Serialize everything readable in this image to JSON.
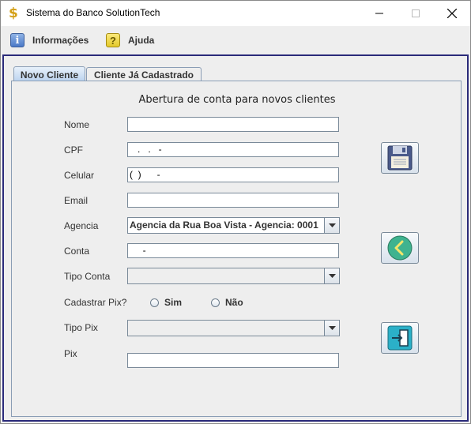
{
  "window": {
    "title": "Sistema do Banco SolutionTech",
    "icon": "dollar-icon",
    "app_icon_glyph": "$"
  },
  "menu": [
    {
      "label": "Informações",
      "icon": "info-icon",
      "glyph": "i"
    },
    {
      "label": "Ajuda",
      "icon": "help-icon",
      "glyph": "?"
    }
  ],
  "tabs": [
    {
      "label": "Novo Cliente",
      "active": true
    },
    {
      "label": "Cliente Já Cadastrado",
      "active": false
    }
  ],
  "form": {
    "heading": "Abertura de conta para novos clientes",
    "nome": {
      "label": "Nome",
      "value": ""
    },
    "cpf": {
      "label": "CPF",
      "value": "   .   .   -"
    },
    "celular": {
      "label": "Celular",
      "value": "(  )      -"
    },
    "email": {
      "label": "Email",
      "value": ""
    },
    "agencia": {
      "label": "Agencia",
      "value": "Agencia da Rua Boa Vista - Agencia: 0001"
    },
    "conta": {
      "label": "Conta",
      "value": "     -"
    },
    "tipo_conta": {
      "label": "Tipo Conta",
      "value": ""
    },
    "cadastrar_pix": {
      "label": "Cadastrar Pix?",
      "options": [
        "Sim",
        "Não"
      ],
      "selected": null
    },
    "tipo_pix": {
      "label": "Tipo Pix",
      "value": ""
    },
    "pix": {
      "label": "Pix",
      "value": ""
    }
  },
  "actions": [
    {
      "name": "save-button",
      "icon": "floppy-disk-icon"
    },
    {
      "name": "back-button",
      "icon": "back-arrow-icon"
    },
    {
      "name": "exit-button",
      "icon": "exit-door-icon"
    }
  ]
}
